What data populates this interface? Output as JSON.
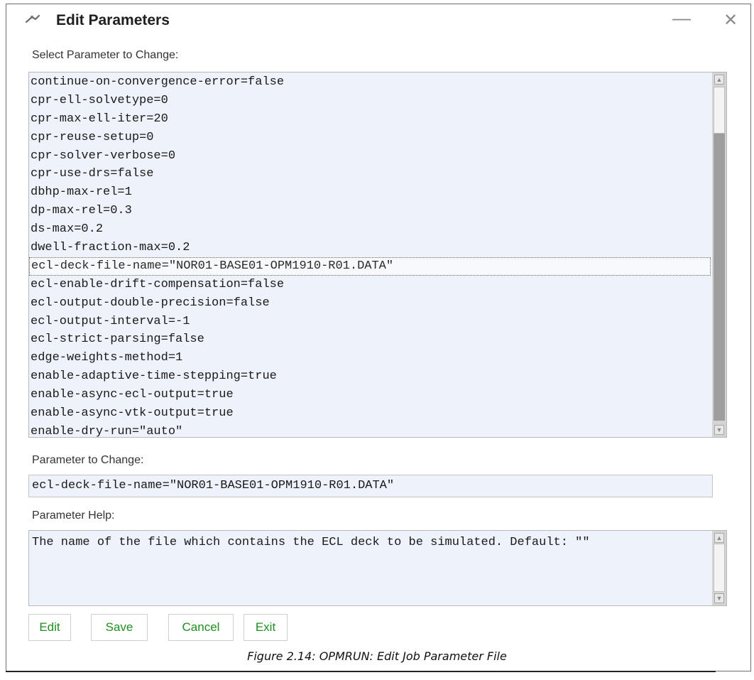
{
  "window": {
    "title": "Edit Parameters",
    "minimize_glyph": "—",
    "close_glyph": "✕"
  },
  "labels": {
    "select_parameter": "Select Parameter to Change:",
    "parameter_to_change": "Parameter to Change:",
    "parameter_help": "Parameter Help:"
  },
  "parameter_list": {
    "items": [
      "continue-on-convergence-error=false",
      "cpr-ell-solvetype=0",
      "cpr-max-ell-iter=20",
      "cpr-reuse-setup=0",
      "cpr-solver-verbose=0",
      "cpr-use-drs=false",
      "dbhp-max-rel=1",
      "dp-max-rel=0.3",
      "ds-max=0.2",
      "dwell-fraction-max=0.2",
      "ecl-deck-file-name=\"NOR01-BASE01-OPM1910-R01.DATA\"",
      "ecl-enable-drift-compensation=false",
      "ecl-output-double-precision=false",
      "ecl-output-interval=-1",
      "ecl-strict-parsing=false",
      "edge-weights-method=1",
      "enable-adaptive-time-stepping=true",
      "enable-async-ecl-output=true",
      "enable-async-vtk-output=true",
      "enable-dry-run=\"auto\""
    ],
    "selected_index": 10
  },
  "parameter_field": {
    "value": "ecl-deck-file-name=\"NOR01-BASE01-OPM1910-R01.DATA\""
  },
  "help": {
    "text": "The name of the file which contains the ECL deck to be simulated. Default: \"\""
  },
  "buttons": {
    "edit": "Edit",
    "save": "Save",
    "cancel": "Cancel",
    "exit": "Exit"
  },
  "caption": "Figure 2.14: OPMRUN: Edit Job Parameter File",
  "icons": {
    "app": "opm-logo-icon",
    "scroll_up": "scroll-up-arrow-icon",
    "scroll_down": "scroll-down-arrow-icon"
  },
  "colors": {
    "button_text": "#1e8f1e",
    "field_background": "#eef2fa"
  }
}
